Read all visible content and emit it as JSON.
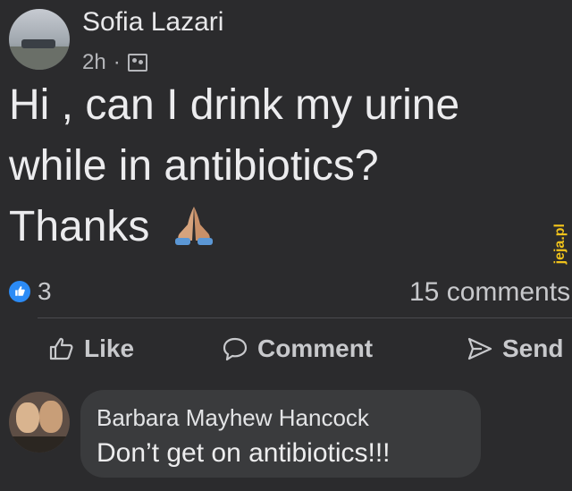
{
  "post": {
    "author": "Sofia Lazari",
    "time": "2h",
    "separator": "·",
    "audience_icon": "custom-audience-icon",
    "text_line1": "Hi , can I drink my urine",
    "text_line2": "while in antibiotics?",
    "text_line3": "Thanks",
    "emoji": "folded-hands-emoji"
  },
  "reactions": {
    "count": "3",
    "comments": "15 comments"
  },
  "actions": {
    "like": "Like",
    "comment": "Comment",
    "send": "Send"
  },
  "comment": {
    "author": "Barbara Mayhew Hancock",
    "text": "Don’t get on antibiotics!!!"
  },
  "watermark": "jeja.pl",
  "colors": {
    "background": "#2b2b2d",
    "bubble": "#3a3b3d",
    "like_blue": "#2b8bf6",
    "text_primary": "#e8e8ea",
    "text_secondary": "#c7c8cb"
  }
}
